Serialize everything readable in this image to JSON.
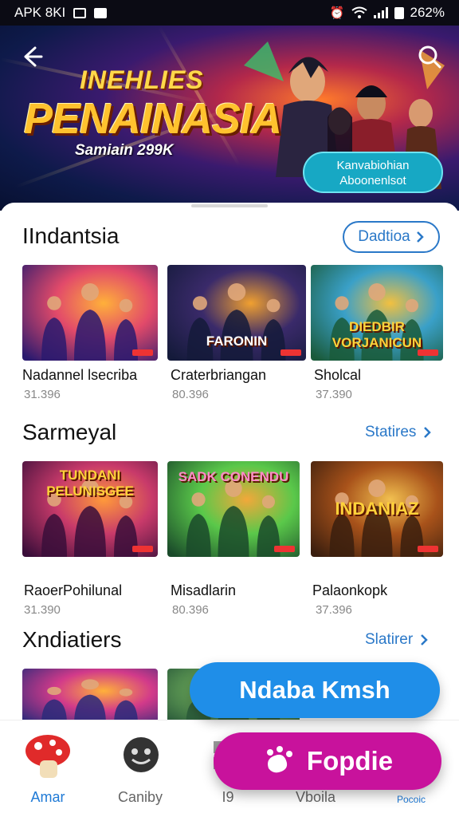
{
  "status_bar": {
    "left_text": "APK 8KI",
    "right_text": "262%"
  },
  "hero": {
    "title_line1": "INEHLIES",
    "title_line2": "PENAINASIA",
    "subtitle": "Samiain 299K",
    "chip_line1": "Kanvabiohian",
    "chip_line2": "Aboonenlsot"
  },
  "sections": [
    {
      "title": "IIndantsia",
      "action_label": "Dadtioa",
      "items": [
        {
          "name": "Nadannel lsecriba",
          "meta": "31.396",
          "art_text": "",
          "colors": [
            "#2a1a6e",
            "#e24a6a",
            "#ffb03a"
          ]
        },
        {
          "name": "Craterbriangan",
          "meta": "80.396",
          "art_text": "FARONIN",
          "colors": [
            "#141a3a",
            "#3a2a6a",
            "#f0a030"
          ]
        },
        {
          "name": "Sholcal",
          "meta": "37.390",
          "art_text": "DIEDBIR VORJANICUN",
          "colors": [
            "#1a5a3a",
            "#3aa0c8",
            "#f2c040"
          ]
        }
      ]
    },
    {
      "title": "Sarmeyal",
      "action_label": "Statires",
      "items": [
        {
          "name": "RaoerPohilunal",
          "meta": "31.390",
          "art_text": "TUNDANI PELUNISGEE",
          "colors": [
            "#3a0e3a",
            "#c83a6a",
            "#ff9a3a"
          ]
        },
        {
          "name": "Misadlarin",
          "meta": "80.396",
          "art_text": "SADK CONENDU",
          "colors": [
            "#1a4a2a",
            "#5ac84a",
            "#f2a83a"
          ]
        },
        {
          "name": "Palaonkopk",
          "meta": "37.396",
          "art_text": "INDANIAZ",
          "colors": [
            "#3a1e0e",
            "#a8521a",
            "#f2c050"
          ]
        }
      ]
    },
    {
      "title": "Xndiatiers",
      "action_label": "Slatirer",
      "items": [
        {
          "name": "",
          "meta": "",
          "art_text": "",
          "colors": [
            "#2a2a7a",
            "#d23a8a",
            "#ffb03a"
          ]
        },
        {
          "name": "",
          "meta": "",
          "art_text": "",
          "colors": [
            "#2a5a3a",
            "#6aa85a",
            "#c8d89a"
          ]
        }
      ]
    }
  ],
  "float_button": {
    "label": "Ndaba Kmsh"
  },
  "fab": {
    "label": "Fopdie"
  },
  "bottom_nav": [
    {
      "label": "Amar",
      "icon": "mushroom-icon",
      "active": true
    },
    {
      "label": "Caniby",
      "icon": "face-icon",
      "active": false
    },
    {
      "label": "I9",
      "icon": "grid-icon",
      "active": false
    },
    {
      "label": "Vboila",
      "icon": "profile-icon",
      "active": false
    },
    {
      "label": "Pocoic",
      "icon": "more-icon",
      "active": true
    }
  ],
  "colors": {
    "accent": "#2a78c8",
    "float_button": "#1f8ee8",
    "fab": "#c8129c",
    "chip": "#17a8c4"
  }
}
